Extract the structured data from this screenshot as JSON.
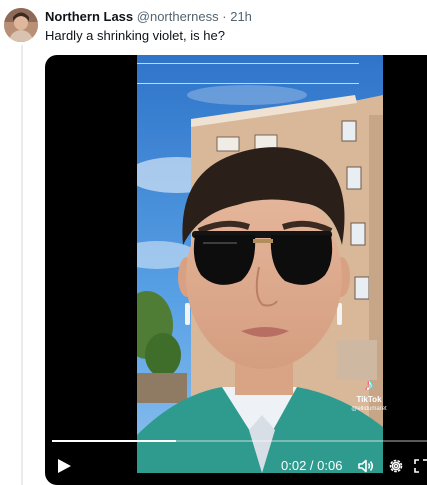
{
  "tweet": {
    "author_name": "Northern Lass",
    "handle": "@northerness",
    "separator": "·",
    "timestamp": "21h",
    "text": "Hardly a shrinking violet, is he?",
    "avatar_icon": "user-avatar"
  },
  "video": {
    "watermark_brand": "TikTok",
    "watermark_user": "@ellidumaret",
    "watermark_icon": "tiktok-note-icon",
    "time_readout": "0:02 / 0:06",
    "progress_fraction": 0.33,
    "controls": {
      "play_icon": "play-icon",
      "volume_icon": "volume-icon",
      "settings_icon": "gear-icon",
      "fullscreen_icon": "fullscreen-icon"
    }
  },
  "colors": {
    "text_primary": "#0f1419",
    "text_secondary": "#536471",
    "video_bg": "#000000",
    "sky": "#3f8fe0"
  }
}
